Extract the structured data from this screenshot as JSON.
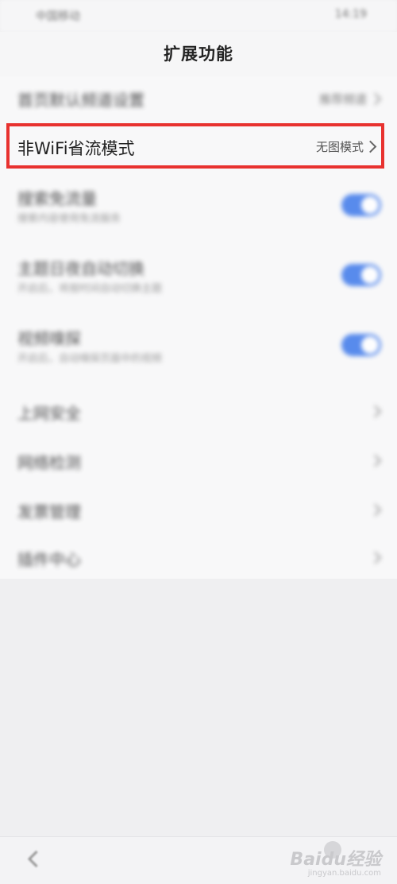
{
  "status_bar": {
    "carrier": "中国移动",
    "time": "14:19"
  },
  "header": {
    "title": "扩展功能"
  },
  "rows": {
    "homepage": {
      "label": "首页默认频道设置",
      "value": "推荐频道"
    },
    "nonwifi": {
      "label": "非WiFi省流模式",
      "value": "无图模式"
    },
    "search_free": {
      "label": "搜索免流量",
      "sub": "搜索内容使用免流服务"
    },
    "theme_switch": {
      "label": "主题日夜自动切换",
      "sub": "开启后，将按时间自动切换主题"
    },
    "video_sniff": {
      "label": "视频嗅探",
      "sub": "开启后，自动嗅探页面中的视频"
    },
    "internet_security": {
      "label": "上网安全"
    },
    "network_check": {
      "label": "网络检测"
    },
    "invoice": {
      "label": "发票管理"
    },
    "plugin_center": {
      "label": "插件中心"
    }
  },
  "toggles": {
    "search_free": true,
    "theme_switch": true,
    "video_sniff": true
  },
  "highlight_color": "#e8322f",
  "toggle_color": "#3d78ea",
  "watermark": {
    "main": "Baidu经验",
    "sub": "jingyan.baidu.com"
  }
}
